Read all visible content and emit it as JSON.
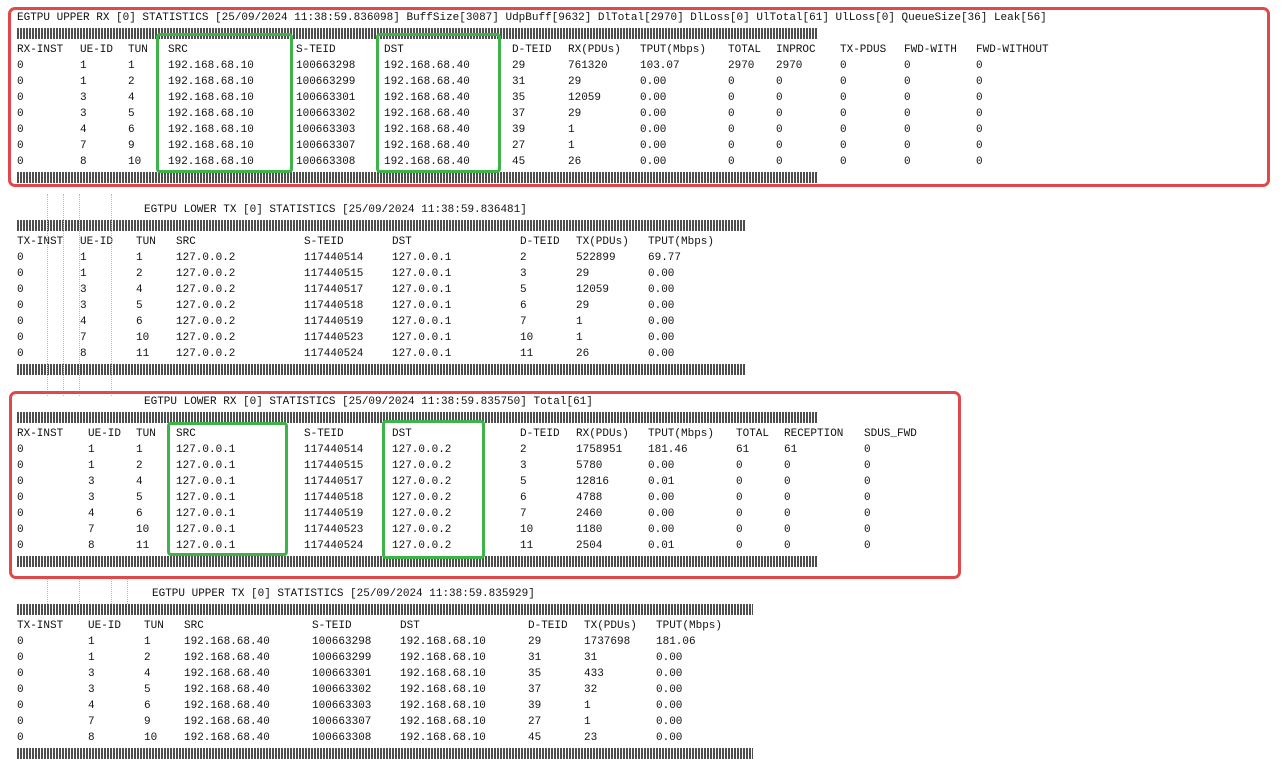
{
  "upper_rx": {
    "title": "EGTPU UPPER RX [0] STATISTICS [25/09/2024 11:38:59.836098] BuffSize[3087] UdpBuff[9632] DlTotal[2970] DlLoss[0] UlTotal[61] UlLoss[0] QueueSize[36] Leak[56]",
    "headers": [
      "RX-INST",
      "UE-ID",
      "TUN",
      "SRC",
      "S-TEID",
      "DST",
      "D-TEID",
      "RX(PDUs)",
      "TPUT(Mbps)",
      "TOTAL",
      "INPROC",
      "TX-PDUS",
      "FWD-WITH",
      "FWD-WITHOUT"
    ],
    "rows": [
      [
        "0",
        "1",
        "1",
        "192.168.68.10",
        "100663298",
        "192.168.68.40",
        "29",
        "761320",
        "103.07",
        "2970",
        "2970",
        "0",
        "0",
        "0"
      ],
      [
        "0",
        "1",
        "2",
        "192.168.68.10",
        "100663299",
        "192.168.68.40",
        "31",
        "29",
        "0.00",
        "0",
        "0",
        "0",
        "0",
        "0"
      ],
      [
        "0",
        "3",
        "4",
        "192.168.68.10",
        "100663301",
        "192.168.68.40",
        "35",
        "12059",
        "0.00",
        "0",
        "0",
        "0",
        "0",
        "0"
      ],
      [
        "0",
        "3",
        "5",
        "192.168.68.10",
        "100663302",
        "192.168.68.40",
        "37",
        "29",
        "0.00",
        "0",
        "0",
        "0",
        "0",
        "0"
      ],
      [
        "0",
        "4",
        "6",
        "192.168.68.10",
        "100663303",
        "192.168.68.40",
        "39",
        "1",
        "0.00",
        "0",
        "0",
        "0",
        "0",
        "0"
      ],
      [
        "0",
        "7",
        "9",
        "192.168.68.10",
        "100663307",
        "192.168.68.40",
        "27",
        "1",
        "0.00",
        "0",
        "0",
        "0",
        "0",
        "0"
      ],
      [
        "0",
        "8",
        "10",
        "192.168.68.10",
        "100663308",
        "192.168.68.40",
        "45",
        "26",
        "0.00",
        "0",
        "0",
        "0",
        "0",
        "0"
      ]
    ]
  },
  "lower_tx": {
    "title": "EGTPU LOWER TX [0] STATISTICS [25/09/2024 11:38:59.836481]",
    "headers": [
      "TX-INST",
      "UE-ID",
      "TUN",
      "SRC",
      "S-TEID",
      "DST",
      "D-TEID",
      "TX(PDUs)",
      "TPUT(Mbps)"
    ],
    "rows": [
      [
        "0",
        "1",
        "1",
        "127.0.0.2",
        "117440514",
        "127.0.0.1",
        "2",
        "522899",
        "69.77"
      ],
      [
        "0",
        "1",
        "2",
        "127.0.0.2",
        "117440515",
        "127.0.0.1",
        "3",
        "29",
        "0.00"
      ],
      [
        "0",
        "3",
        "4",
        "127.0.0.2",
        "117440517",
        "127.0.0.1",
        "5",
        "12059",
        "0.00"
      ],
      [
        "0",
        "3",
        "5",
        "127.0.0.2",
        "117440518",
        "127.0.0.1",
        "6",
        "29",
        "0.00"
      ],
      [
        "0",
        "4",
        "6",
        "127.0.0.2",
        "117440519",
        "127.0.0.1",
        "7",
        "1",
        "0.00"
      ],
      [
        "0",
        "7",
        "10",
        "127.0.0.2",
        "117440523",
        "127.0.0.1",
        "10",
        "1",
        "0.00"
      ],
      [
        "0",
        "8",
        "11",
        "127.0.0.2",
        "117440524",
        "127.0.0.1",
        "11",
        "26",
        "0.00"
      ]
    ]
  },
  "lower_rx": {
    "title": "EGTPU LOWER RX [0] STATISTICS [25/09/2024 11:38:59.835750] Total[61]",
    "headers": [
      "RX-INST",
      "UE-ID",
      "TUN",
      "SRC",
      "S-TEID",
      "DST",
      "D-TEID",
      "RX(PDUs)",
      "TPUT(Mbps)",
      "TOTAL",
      "RECEPTION",
      "SDUS_FWD"
    ],
    "rows": [
      [
        "0",
        "1",
        "1",
        "127.0.0.1",
        "117440514",
        "127.0.0.2",
        "2",
        "1758951",
        "181.46",
        "61",
        "61",
        "0"
      ],
      [
        "0",
        "1",
        "2",
        "127.0.0.1",
        "117440515",
        "127.0.0.2",
        "3",
        "5780",
        "0.00",
        "0",
        "0",
        "0"
      ],
      [
        "0",
        "3",
        "4",
        "127.0.0.1",
        "117440517",
        "127.0.0.2",
        "5",
        "12816",
        "0.01",
        "0",
        "0",
        "0"
      ],
      [
        "0",
        "3",
        "5",
        "127.0.0.1",
        "117440518",
        "127.0.0.2",
        "6",
        "4788",
        "0.00",
        "0",
        "0",
        "0"
      ],
      [
        "0",
        "4",
        "6",
        "127.0.0.1",
        "117440519",
        "127.0.0.2",
        "7",
        "2460",
        "0.00",
        "0",
        "0",
        "0"
      ],
      [
        "0",
        "7",
        "10",
        "127.0.0.1",
        "117440523",
        "127.0.0.2",
        "10",
        "1180",
        "0.00",
        "0",
        "0",
        "0"
      ],
      [
        "0",
        "8",
        "11",
        "127.0.0.1",
        "117440524",
        "127.0.0.2",
        "11",
        "2504",
        "0.01",
        "0",
        "0",
        "0"
      ]
    ]
  },
  "upper_tx": {
    "title": "EGTPU UPPER TX [0] STATISTICS [25/09/2024 11:38:59.835929]",
    "headers": [
      "TX-INST",
      "UE-ID",
      "TUN",
      "SRC",
      "S-TEID",
      "DST",
      "D-TEID",
      "TX(PDUs)",
      "TPUT(Mbps)"
    ],
    "rows": [
      [
        "0",
        "1",
        "1",
        "192.168.68.40",
        "100663298",
        "192.168.68.10",
        "29",
        "1737698",
        "181.06"
      ],
      [
        "0",
        "1",
        "2",
        "192.168.68.40",
        "100663299",
        "192.168.68.10",
        "31",
        "31",
        "0.00"
      ],
      [
        "0",
        "3",
        "4",
        "192.168.68.40",
        "100663301",
        "192.168.68.10",
        "35",
        "433",
        "0.00"
      ],
      [
        "0",
        "3",
        "5",
        "192.168.68.40",
        "100663302",
        "192.168.68.10",
        "37",
        "32",
        "0.00"
      ],
      [
        "0",
        "4",
        "6",
        "192.168.68.40",
        "100663303",
        "192.168.68.10",
        "39",
        "1",
        "0.00"
      ],
      [
        "0",
        "7",
        "9",
        "192.168.68.40",
        "100663307",
        "192.168.68.10",
        "27",
        "1",
        "0.00"
      ],
      [
        "0",
        "8",
        "10",
        "192.168.68.40",
        "100663308",
        "192.168.68.10",
        "45",
        "23",
        "0.00"
      ]
    ]
  },
  "colors": {
    "highlight_red": "#e0484b",
    "highlight_green": "#3db34a",
    "text": "#111111",
    "background": "#ffffff"
  }
}
